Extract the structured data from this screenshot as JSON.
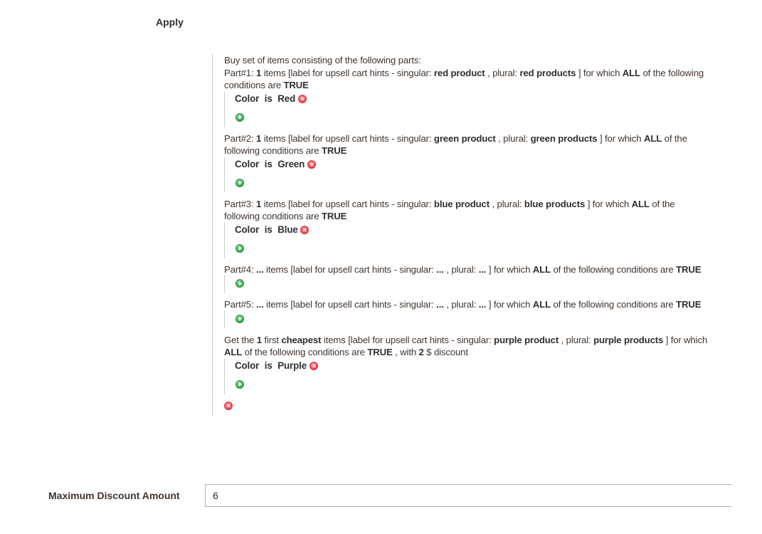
{
  "apply": {
    "label": "Apply"
  },
  "rule": {
    "intro": "Buy set of items consisting of the following parts:",
    "parts": [
      {
        "prefix": "Part#1:",
        "qty": "1",
        "text1": " items [label for upsell cart hints - singular:",
        "singular": "red product",
        "text2": ", plural:",
        "plural": "red products",
        "text3": "] for which",
        "aggregator": "ALL",
        "text4": " of the following conditions are",
        "value": "TRUE",
        "conditions": [
          {
            "attribute": "Color",
            "operator": "is",
            "value": "Red"
          }
        ]
      },
      {
        "prefix": "Part#2:",
        "qty": "1",
        "text1": " items [label for upsell cart hints - singular:",
        "singular": "green product",
        "text2": ", plural:",
        "plural": "green products",
        "text3": "] for which",
        "aggregator": "ALL",
        "text4": " of the following conditions are",
        "value": "TRUE",
        "conditions": [
          {
            "attribute": "Color",
            "operator": "is",
            "value": "Green"
          }
        ]
      },
      {
        "prefix": "Part#3:",
        "qty": "1",
        "text1": " items [label for upsell cart hints - singular:",
        "singular": "blue product",
        "text2": ", plural:",
        "plural": "blue products",
        "text3": "] for which",
        "aggregator": "ALL",
        "text4": " of the following conditions are",
        "value": "TRUE",
        "conditions": [
          {
            "attribute": "Color",
            "operator": "is",
            "value": "Blue"
          }
        ]
      },
      {
        "prefix": "Part#4:",
        "qty": "...",
        "text1": " items [label for upsell cart hints - singular:",
        "singular": "...",
        "text2": ", plural:",
        "plural": "...",
        "text3": "] for which",
        "aggregator": "ALL",
        "text4": " of the following conditions are",
        "value": "TRUE",
        "conditions": []
      },
      {
        "prefix": "Part#5:",
        "qty": "...",
        "text1": " items [label for upsell cart hints - singular:",
        "singular": "...",
        "text2": ", plural:",
        "plural": "...",
        "text3": "] for which",
        "aggregator": "ALL",
        "text4": " of the following conditions are",
        "value": "TRUE",
        "conditions": []
      }
    ],
    "get": {
      "text0": "Get the",
      "qty": "1",
      "text1": " first",
      "sort": "cheapest",
      "text2": " items [label for upsell cart hints - singular:",
      "singular": "purple product",
      "text3": ", plural:",
      "plural": "purple products",
      "text4": "] for which",
      "aggregator": "ALL",
      "text5": " of the following conditions are",
      "value": "TRUE",
      "text6": ", with",
      "discount": "2",
      "text7": "$ discount",
      "conditions": [
        {
          "attribute": "Color",
          "operator": "is",
          "value": "Purple"
        }
      ]
    },
    "icons": {
      "remove": "remove-icon",
      "add": "add-icon"
    }
  },
  "max_discount": {
    "label": "Maximum Discount Amount",
    "value": "6"
  }
}
